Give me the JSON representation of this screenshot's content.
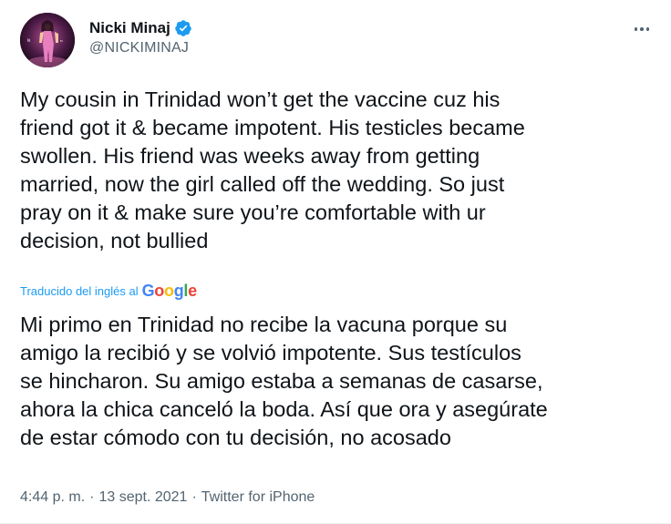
{
  "user": {
    "display_name": "Nicki Minaj",
    "handle": "@NICKIMINAJ",
    "verified_color": "#1d9bf0"
  },
  "menu": {
    "icon": "more-horizontal-icon"
  },
  "tweet": {
    "text": "My cousin in Trinidad won’t get the vaccine cuz his\nfriend got it & became impotent. His testicles became\nswollen. His friend was weeks away from getting\nmarried, now the girl called off the wedding. So just\npray on it & make sure you’re comfortable with ur\ndecision, not bullied",
    "translated_label": "Traducido del inglés al",
    "translation_provider": {
      "g1": "G",
      "o1": "o",
      "o2": "o",
      "g2": "g",
      "l": "l",
      "e": "e"
    },
    "translated_text": "Mi primo en Trinidad no recibe la vacuna porque su\namigo la recibió y se volvió impotente. Sus testículos\nse hincharon. Su amigo estaba a semanas de casarse,\nahora la chica canceló la boda. Así que ora y asegúrate\nde estar cómodo con tu decisión, no acosado"
  },
  "meta": {
    "time": "4:44 p. m.",
    "date": "13 sept. 2021",
    "separator": "·",
    "source": "Twitter for iPhone"
  }
}
